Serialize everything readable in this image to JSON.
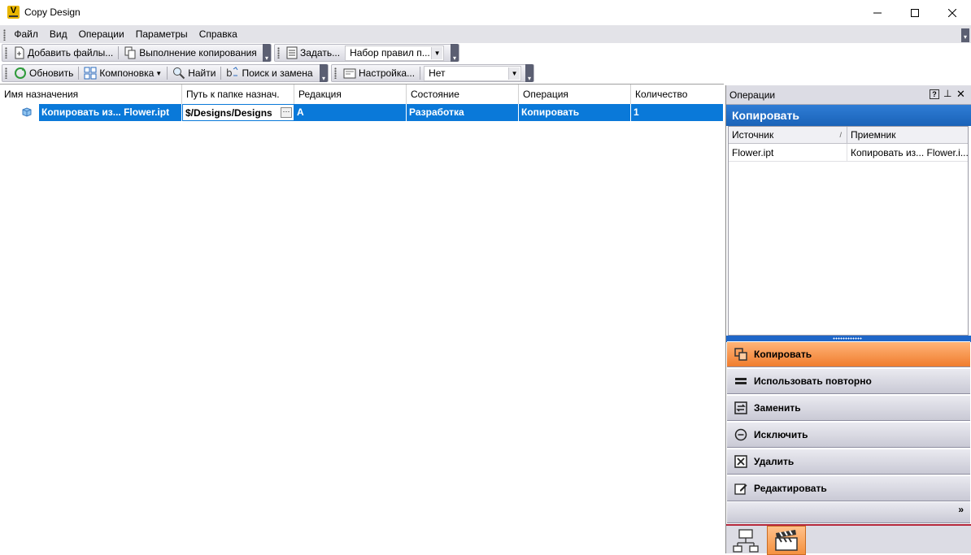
{
  "window": {
    "title": "Copy Design"
  },
  "menu": [
    "Файл",
    "Вид",
    "Операции",
    "Параметры",
    "Справка"
  ],
  "toolbar1": {
    "add_files": "Добавить файлы...",
    "execute_copy": "Выполнение копирования",
    "set": "Задать...",
    "ruleset_value": "Набор правил п..."
  },
  "toolbar2": {
    "refresh": "Обновить",
    "layout": "Компоновка",
    "find": "Найти",
    "find_replace": "Поиск и замена",
    "settings": "Настройка...",
    "filter_value": "Нет"
  },
  "grid": {
    "columns": [
      "Имя назначения",
      "Путь к папке назнач.",
      "Редакция",
      "Состояние",
      "Операция",
      "Количество"
    ],
    "rows": [
      {
        "name": "Копировать из... Flower.ipt",
        "path": "$/Designs/Designs",
        "revision": "A",
        "state": "Разработка",
        "operation": "Копировать",
        "quantity": "1"
      }
    ]
  },
  "panel": {
    "title": "Операции",
    "header": "Копировать",
    "columns": [
      "Источник",
      "Приемник"
    ],
    "rows": [
      {
        "source": "Flower.ipt",
        "target": "Копировать из... Flower.i..."
      }
    ],
    "actions": [
      "Копировать",
      "Использовать повторно",
      "Заменить",
      "Исключить",
      "Удалить",
      "Редактировать"
    ],
    "active_action": "Копировать"
  },
  "colors": {
    "selection": "#0a79d9",
    "panel_header": "#1f67c8",
    "active_action": "#f5913f"
  }
}
